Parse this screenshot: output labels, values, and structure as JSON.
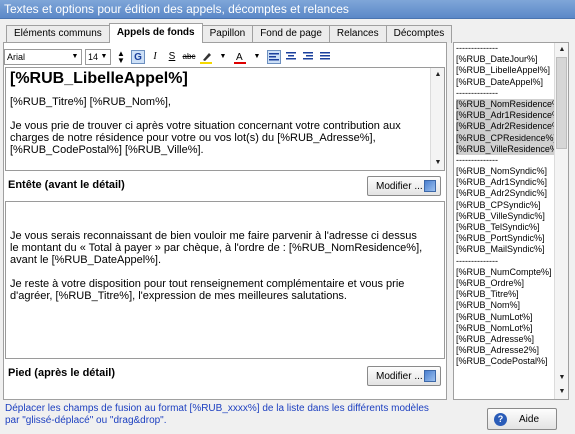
{
  "window": {
    "title": "Textes et options pour édition des appels, décomptes et relances"
  },
  "tabs": [
    "Eléments communs",
    "Appels de fonds",
    "Papillon",
    "Fond de page",
    "Relances",
    "Décomptes"
  ],
  "active_tab": "Appels de fonds",
  "toolbar": {
    "font": "Arial",
    "size": "14"
  },
  "header_editor": {
    "title": "[%RUB_LibelleAppel%]",
    "line1": "[%RUB_Titre%] [%RUB_Nom%],",
    "line2": "Je vous prie de trouver ci après votre situation concernant votre contribution aux charges de notre résidence pour votre ou vos lot(s) du [%RUB_Adresse%], [%RUB_CodePostal%] [%RUB_Ville%].",
    "label": "Entête (avant le détail)",
    "button": "Modifier ..."
  },
  "footer_editor": {
    "line1": "Je vous serais reconnaissant de bien vouloir me faire parvenir à l'adresse ci dessus le montant du « Total à payer » par chèque, à l'ordre de : [%RUB_NomResidence%], avant le [%RUB_DateAppel%].",
    "line2": "Je reste à votre disposition pour tout renseignement complémentaire et vous prie d'agréer, [%RUB_Titre%], l'expression de mes meilleures salutations.",
    "label": "Pied (après le détail)",
    "button": "Modifier ..."
  },
  "fields": [
    "--------------",
    "[%RUB_DateJour%]",
    "[%RUB_LibelleAppel%]",
    "[%RUB_DateAppel%]",
    "--------------",
    "[%RUB_NomResidence%]",
    "[%RUB_Adr1Residence%]",
    "[%RUB_Adr2Residence%]",
    "[%RUB_CPResidence%]",
    "[%RUB_VilleResidence%]",
    "--------------",
    "[%RUB_NomSyndic%]",
    "[%RUB_Adr1Syndic%]",
    "[%RUB_Adr2Syndic%]",
    "[%RUB_CPSyndic%]",
    "[%RUB_VilleSyndic%]",
    "[%RUB_TelSyndic%]",
    "[%RUB_PortSyndic%]",
    "[%RUB_MailSyndic%]",
    "--------------",
    "[%RUB_NumCompte%]",
    "[%RUB_Ordre%]",
    "[%RUB_Titre%]",
    "[%RUB_Nom%]",
    "[%RUB_NumLot%]",
    "[%RUB_NomLot%]",
    "[%RUB_Adresse%]",
    "[%RUB_Adresse2%]",
    "[%RUB_CodePostal%]"
  ],
  "selected_fields": [
    5,
    6,
    7,
    8,
    9
  ],
  "footer": {
    "hint": "Déplacer les champs de fusion au format [%RUB_xxxx%] de la liste dans les différents modèles par \"glissé-déplacé\" ou \"drag&drop\".",
    "help_button": "Aide"
  }
}
